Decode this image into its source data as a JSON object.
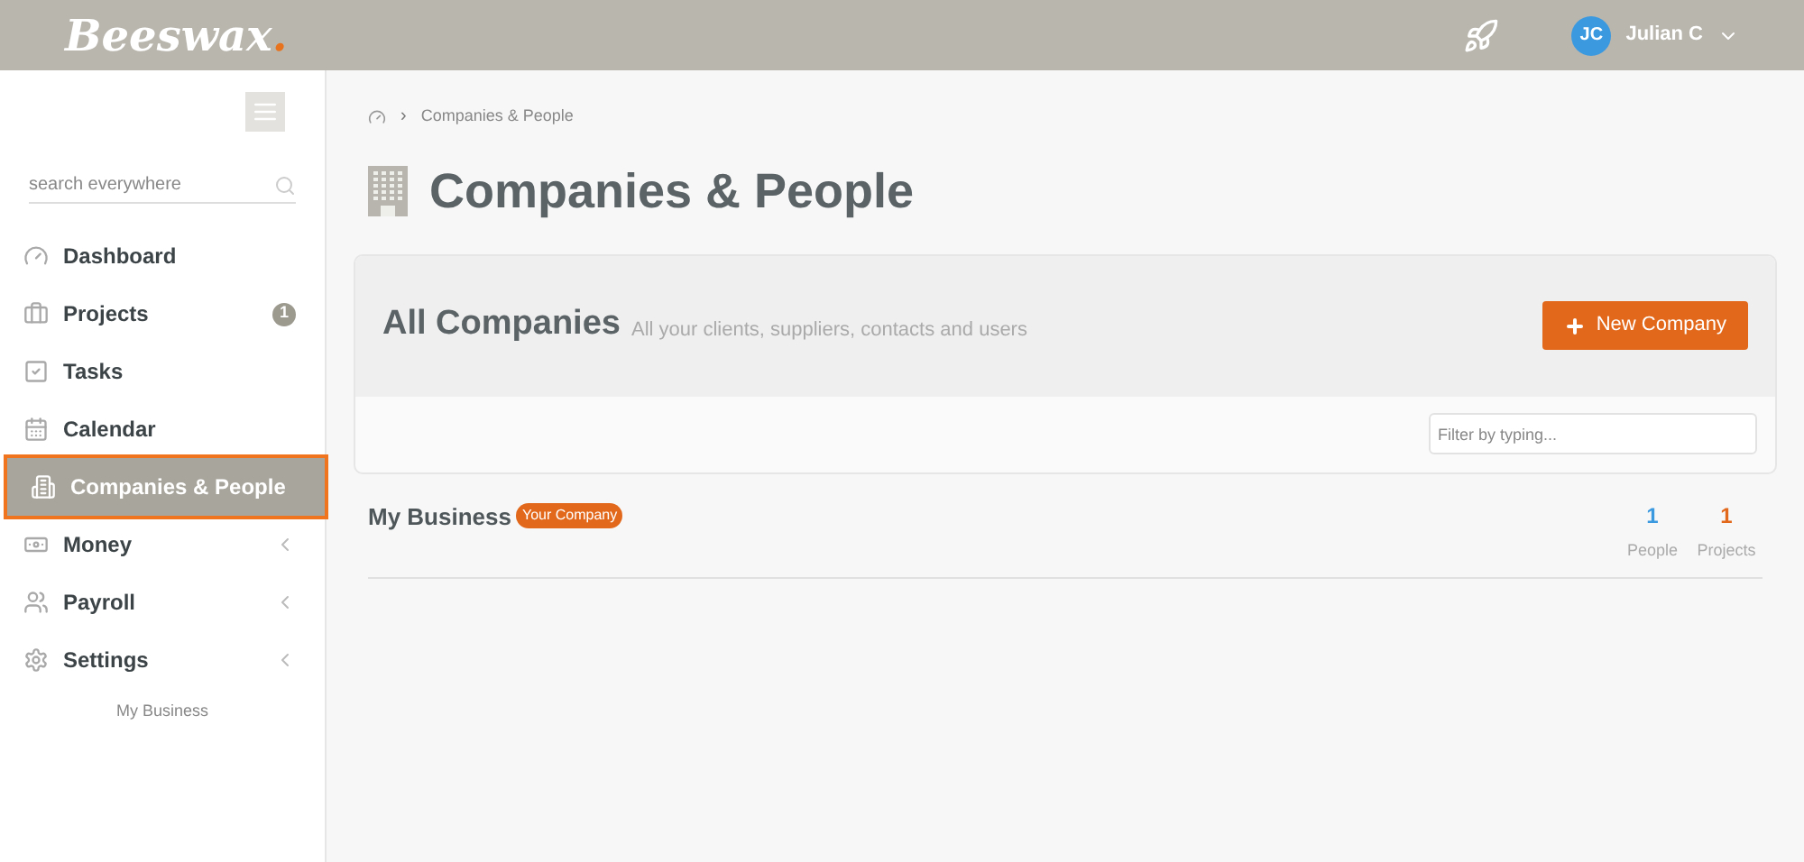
{
  "header": {
    "logo": "Beeswax",
    "logo_dot": ".",
    "user": {
      "initials": "JC",
      "name": "Julian C"
    }
  },
  "sidebar": {
    "search": {
      "placeholder": "search everywhere"
    },
    "items": [
      {
        "label": "Dashboard",
        "selected": false,
        "collapsed": false
      },
      {
        "label": "Projects",
        "selected": false,
        "collapsed": false,
        "badge": "1"
      },
      {
        "label": "Tasks",
        "selected": false,
        "collapsed": false
      },
      {
        "label": "Calendar",
        "selected": false,
        "collapsed": false
      },
      {
        "label": "Companies & People",
        "selected": true,
        "collapsed": false
      },
      {
        "label": "Money",
        "selected": false,
        "collapsed": true
      },
      {
        "label": "Payroll",
        "selected": false,
        "collapsed": true
      },
      {
        "label": "Settings",
        "selected": false,
        "collapsed": true
      }
    ],
    "footer": "My Business"
  },
  "breadcrumb_separator": "›",
  "breadcrumb": [
    "Companies & People"
  ],
  "page_title": "Companies & People",
  "panel": {
    "title": "All Companies",
    "subtitle": "All your clients, suppliers, contacts and users",
    "button": "New Company",
    "filter": {
      "placeholder": "Filter by typing..."
    }
  },
  "companies": [
    {
      "name": "My Business",
      "tag": "Your Company",
      "people": "1",
      "people_label": "People",
      "projects": "1",
      "projects_label": "Projects"
    }
  ]
}
